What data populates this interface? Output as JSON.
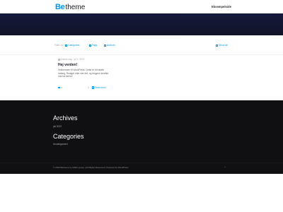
{
  "header": {
    "logo_be": "Be",
    "logo_theme": "theme",
    "nav_link": "Eksempelside"
  },
  "filters": {
    "filter_by": "Filter by",
    "categories": "Categories",
    "tags": "Tags",
    "authors": "Authors",
    "show_all": "Show all"
  },
  "post": {
    "meta": "Kasnik dag · jul 9, 2023",
    "title": "Hej verden!",
    "excerpt": "Velkommen til WordPress. Dette er dit første indlæg. Rediger eller slet det, og begynd derefter med at skrive!",
    "comments": "1",
    "likes": "0",
    "read_more": "Read more"
  },
  "footer": {
    "archives_title": "Archives",
    "archives_link": "juli 2023",
    "categories_title": "Categories",
    "categories_link": "Uncategorized",
    "copyright": "© 2023 Betheme by Muffin group | All Rights Reserved | Powered by WordPress",
    "back_to_top": "^"
  },
  "colors": {
    "accent": "#0095eb",
    "hero": "#141733",
    "footer_bg": "#101012"
  }
}
